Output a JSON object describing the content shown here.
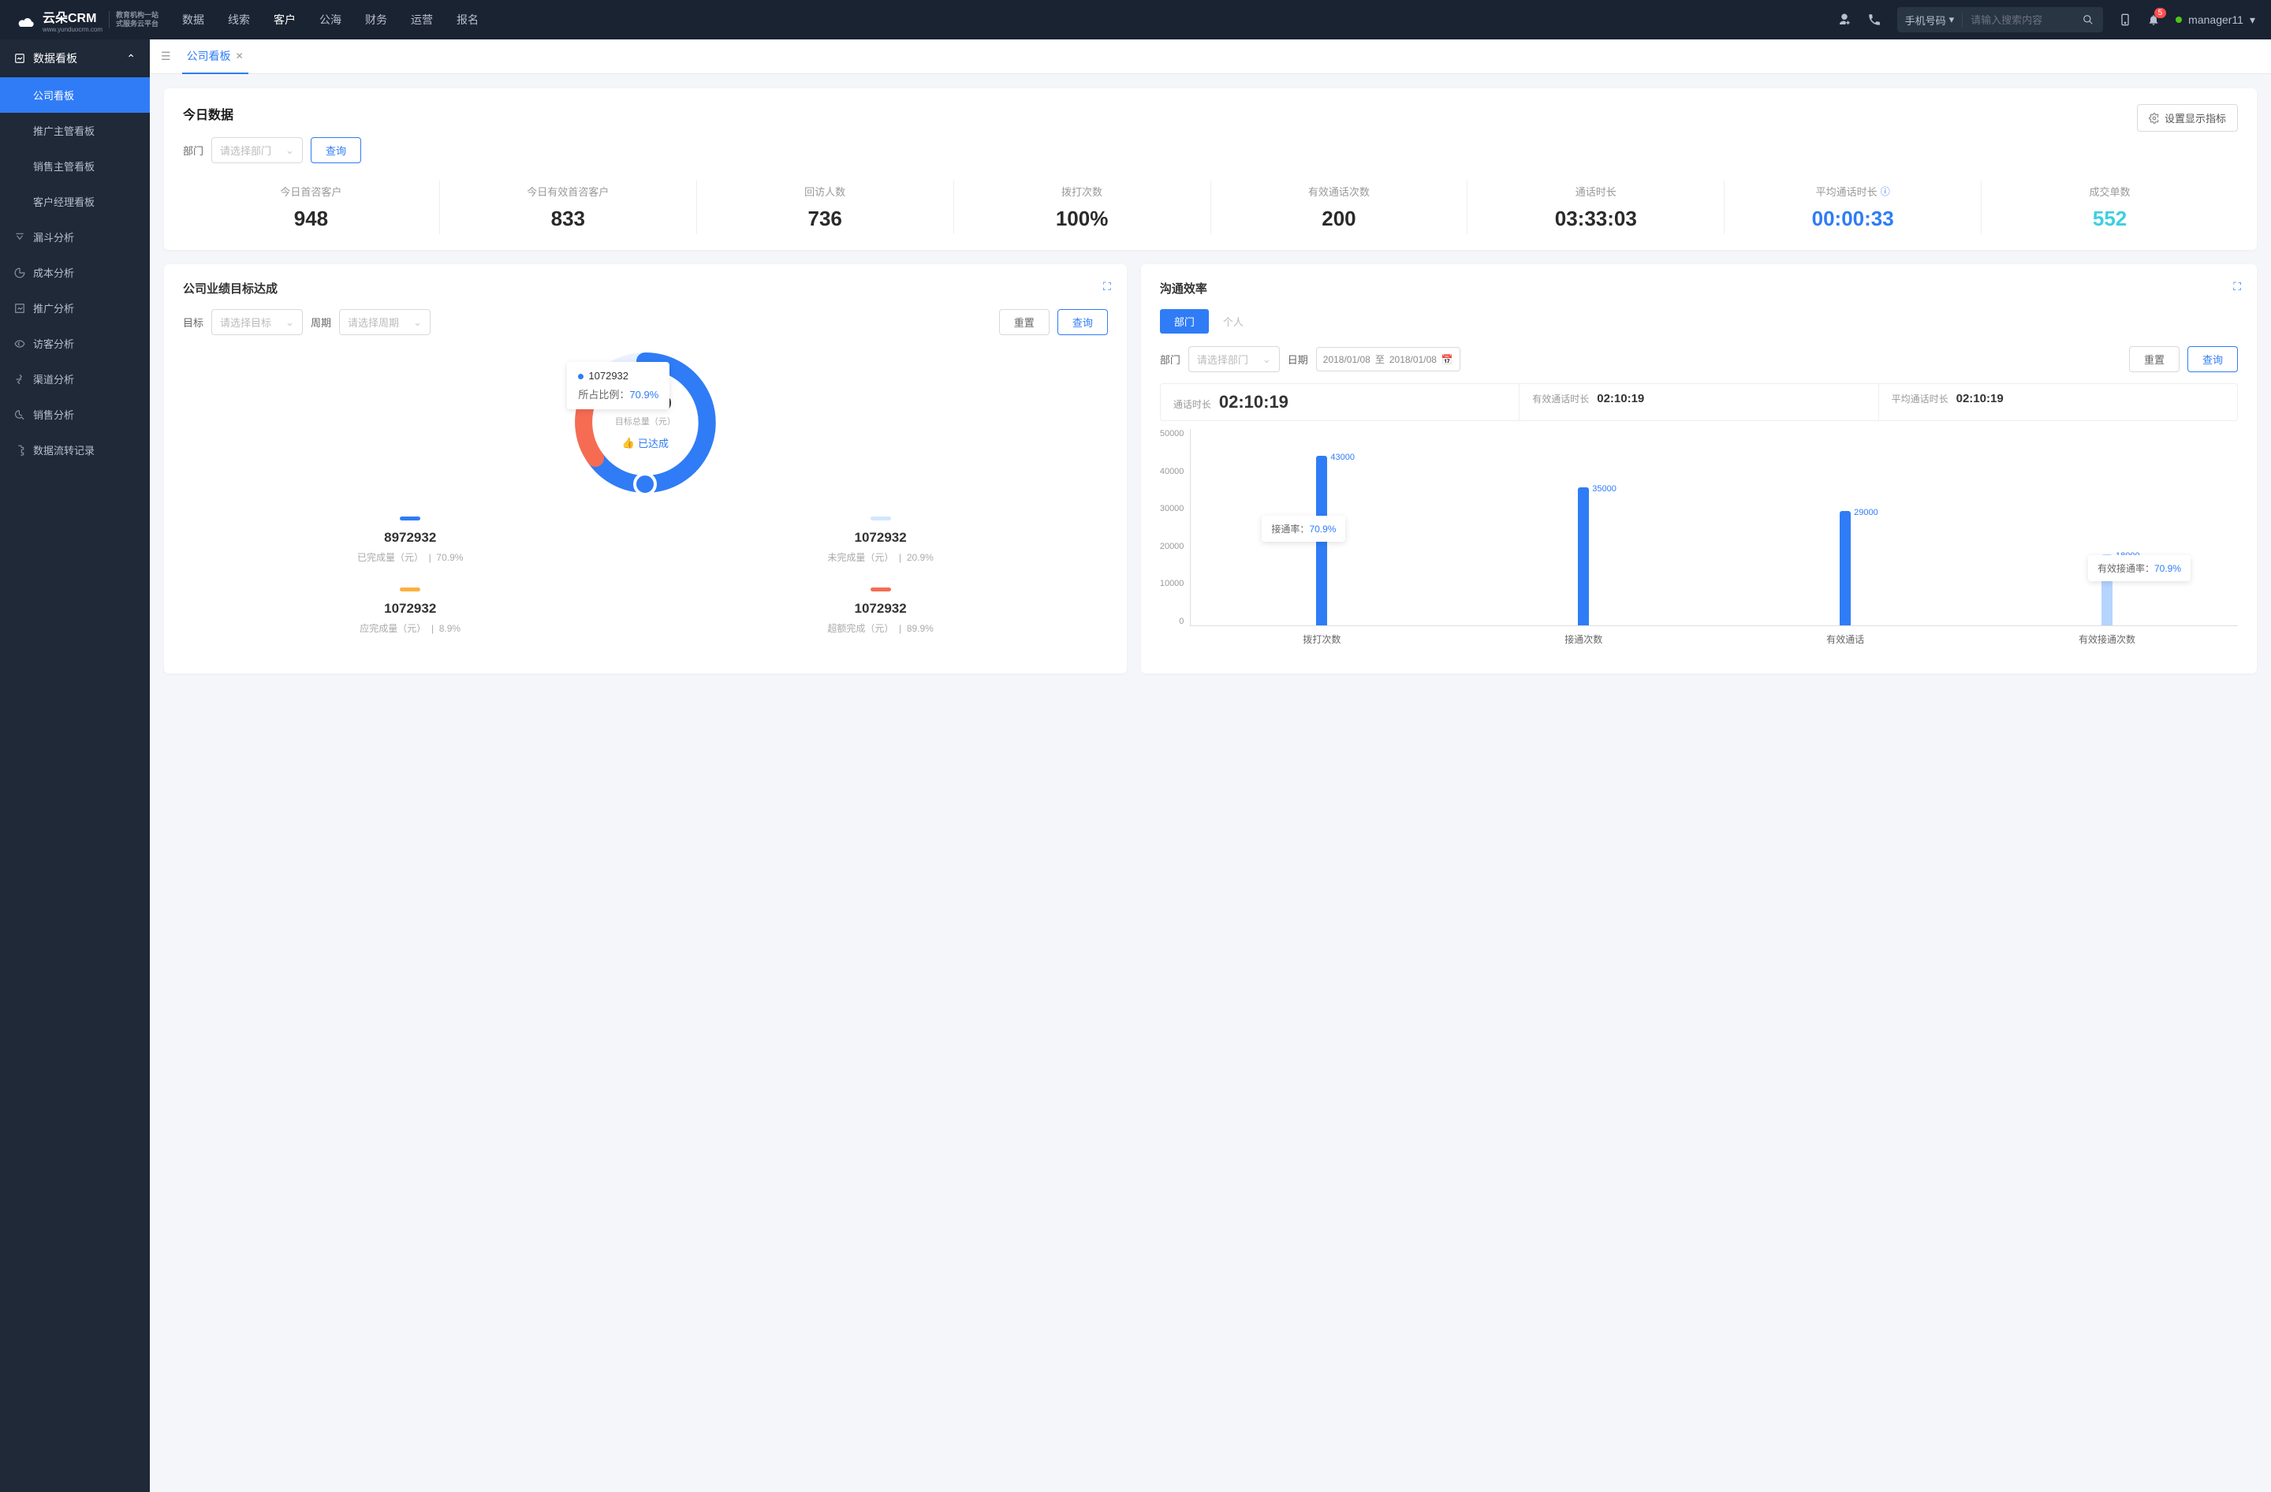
{
  "brand": {
    "name": "云朵CRM",
    "sub1": "教育机构一站",
    "sub2": "式服务云平台",
    "domain": "www.yunduocrm.com"
  },
  "nav": {
    "items": [
      "数据",
      "线索",
      "客户",
      "公海",
      "财务",
      "运营",
      "报名"
    ],
    "activeIndex": 2
  },
  "search": {
    "type": "手机号码",
    "placeholder": "请输入搜索内容"
  },
  "notif_count": "5",
  "user": {
    "name": "manager11"
  },
  "sidebar": {
    "group": {
      "title": "数据看板",
      "items": [
        "公司看板",
        "推广主管看板",
        "销售主管看板",
        "客户经理看板"
      ],
      "activeIndex": 0
    },
    "singles": [
      "漏斗分析",
      "成本分析",
      "推广分析",
      "访客分析",
      "渠道分析",
      "销售分析",
      "数据流转记录"
    ]
  },
  "tabs": {
    "current": "公司看板"
  },
  "today": {
    "title": "今日数据",
    "dept_label": "部门",
    "dept_placeholder": "请选择部门",
    "query": "查询",
    "settings": "设置显示指标",
    "metrics": [
      {
        "label": "今日首咨客户",
        "value": "948",
        "style": ""
      },
      {
        "label": "今日有效首咨客户",
        "value": "833",
        "style": ""
      },
      {
        "label": "回访人数",
        "value": "736",
        "style": ""
      },
      {
        "label": "拨打次数",
        "value": "100%",
        "style": ""
      },
      {
        "label": "有效通话次数",
        "value": "200",
        "style": ""
      },
      {
        "label": "通话时长",
        "value": "03:33:03",
        "style": ""
      },
      {
        "label": "平均通话时长",
        "value": "00:00:33",
        "style": "blue",
        "info": true
      },
      {
        "label": "成交单数",
        "value": "552",
        "style": "cyan"
      }
    ]
  },
  "goal": {
    "title": "公司业绩目标达成",
    "target_label": "目标",
    "target_placeholder": "请选择目标",
    "period_label": "周期",
    "period_placeholder": "请选择周期",
    "reset": "重置",
    "query": "查询",
    "center_num": "100000",
    "center_sub": "目标总量（元）",
    "status": "已达成",
    "tooltip_val": "1072932",
    "tooltip_pct_label": "所占比例：",
    "tooltip_pct": "70.9%",
    "legends": [
      {
        "color": "#2f7cf6",
        "num": "8972932",
        "sub": "已完成量（元）",
        "pct": "70.9%"
      },
      {
        "color": "#d3e6ff",
        "num": "1072932",
        "sub": "未完成量（元）",
        "pct": "20.9%"
      },
      {
        "color": "#fbb040",
        "num": "1072932",
        "sub": "应完成量（元）",
        "pct": "8.9%"
      },
      {
        "color": "#f56c53",
        "num": "1072932",
        "sub": "超额完成（元）",
        "pct": "89.9%"
      }
    ]
  },
  "eff": {
    "title": "沟通效率",
    "tab_dept": "部门",
    "tab_person": "个人",
    "dept_label": "部门",
    "dept_placeholder": "请选择部门",
    "date_label": "日期",
    "date_from": "2018/01/08",
    "date_to": "2018/01/08",
    "date_sep": "至",
    "reset": "重置",
    "query": "查询",
    "durations": [
      {
        "label": "通话时长",
        "value": "02:10:19",
        "big": true
      },
      {
        "label": "有效通话时长",
        "value": "02:10:19"
      },
      {
        "label": "平均通话时长",
        "value": "02:10:19"
      }
    ],
    "tooltip1_label": "接通率：",
    "tooltip1_val": "70.9%",
    "tooltip2_label": "有效接通率：",
    "tooltip2_val": "70.9%"
  },
  "chart_data": {
    "type": "bar",
    "categories": [
      "拨打次数",
      "接通次数",
      "有效通话",
      "有效接通次数"
    ],
    "values": [
      43000,
      35000,
      29000,
      18000
    ],
    "light_bars": [
      false,
      false,
      false,
      true
    ],
    "ylim": [
      0,
      50000
    ],
    "yticks": [
      0,
      10000,
      20000,
      30000,
      40000,
      50000
    ]
  }
}
